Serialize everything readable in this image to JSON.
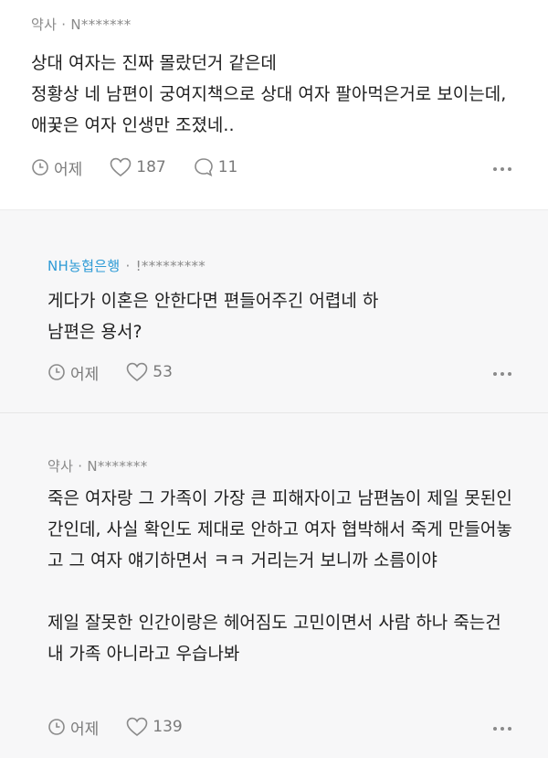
{
  "comments": [
    {
      "author": "약사 · N*******",
      "text": "상대 여자는 진짜 몰랐던거 같은데\n정황상 네 남편이 궁여지책으로 상대 여자 팔아먹은거로 보이는데, 애꿎은 여자 인생만 조졌네..",
      "time": "어제",
      "likes": "187",
      "replies": "11"
    },
    {
      "company": "NH농협은행",
      "user": "!*********",
      "text": "게다가 이혼은 안한다면 편들어주긴 어렵네 하\n남편은 용서?",
      "time": "어제",
      "likes": "53"
    },
    {
      "author": "약사 · N*******",
      "text": "죽은 여자랑 그 가족이 가장 큰 피해자이고 남편놈이 제일 못된인간인데, 사실 확인도 제대로 안하고 여자 협박해서 죽게 만들어놓고 그 여자 얘기하면서 ㅋㅋ 거리는거 보니까 소름이야\n\n제일 잘못한 인간이랑은 헤어짐도 고민이면서 사람 하나 죽는건 내 가족 아니라고 우습나봐",
      "time": "어제",
      "likes": "139"
    }
  ],
  "icons": {
    "time": "clock-icon",
    "like": "heart-icon",
    "reply": "speech-bubble-icon",
    "more": "more-dots-icon"
  },
  "colors": {
    "company": "#2e9bd6",
    "meta": "#7a7a7a",
    "reply_bg": "#f7f7f8"
  }
}
